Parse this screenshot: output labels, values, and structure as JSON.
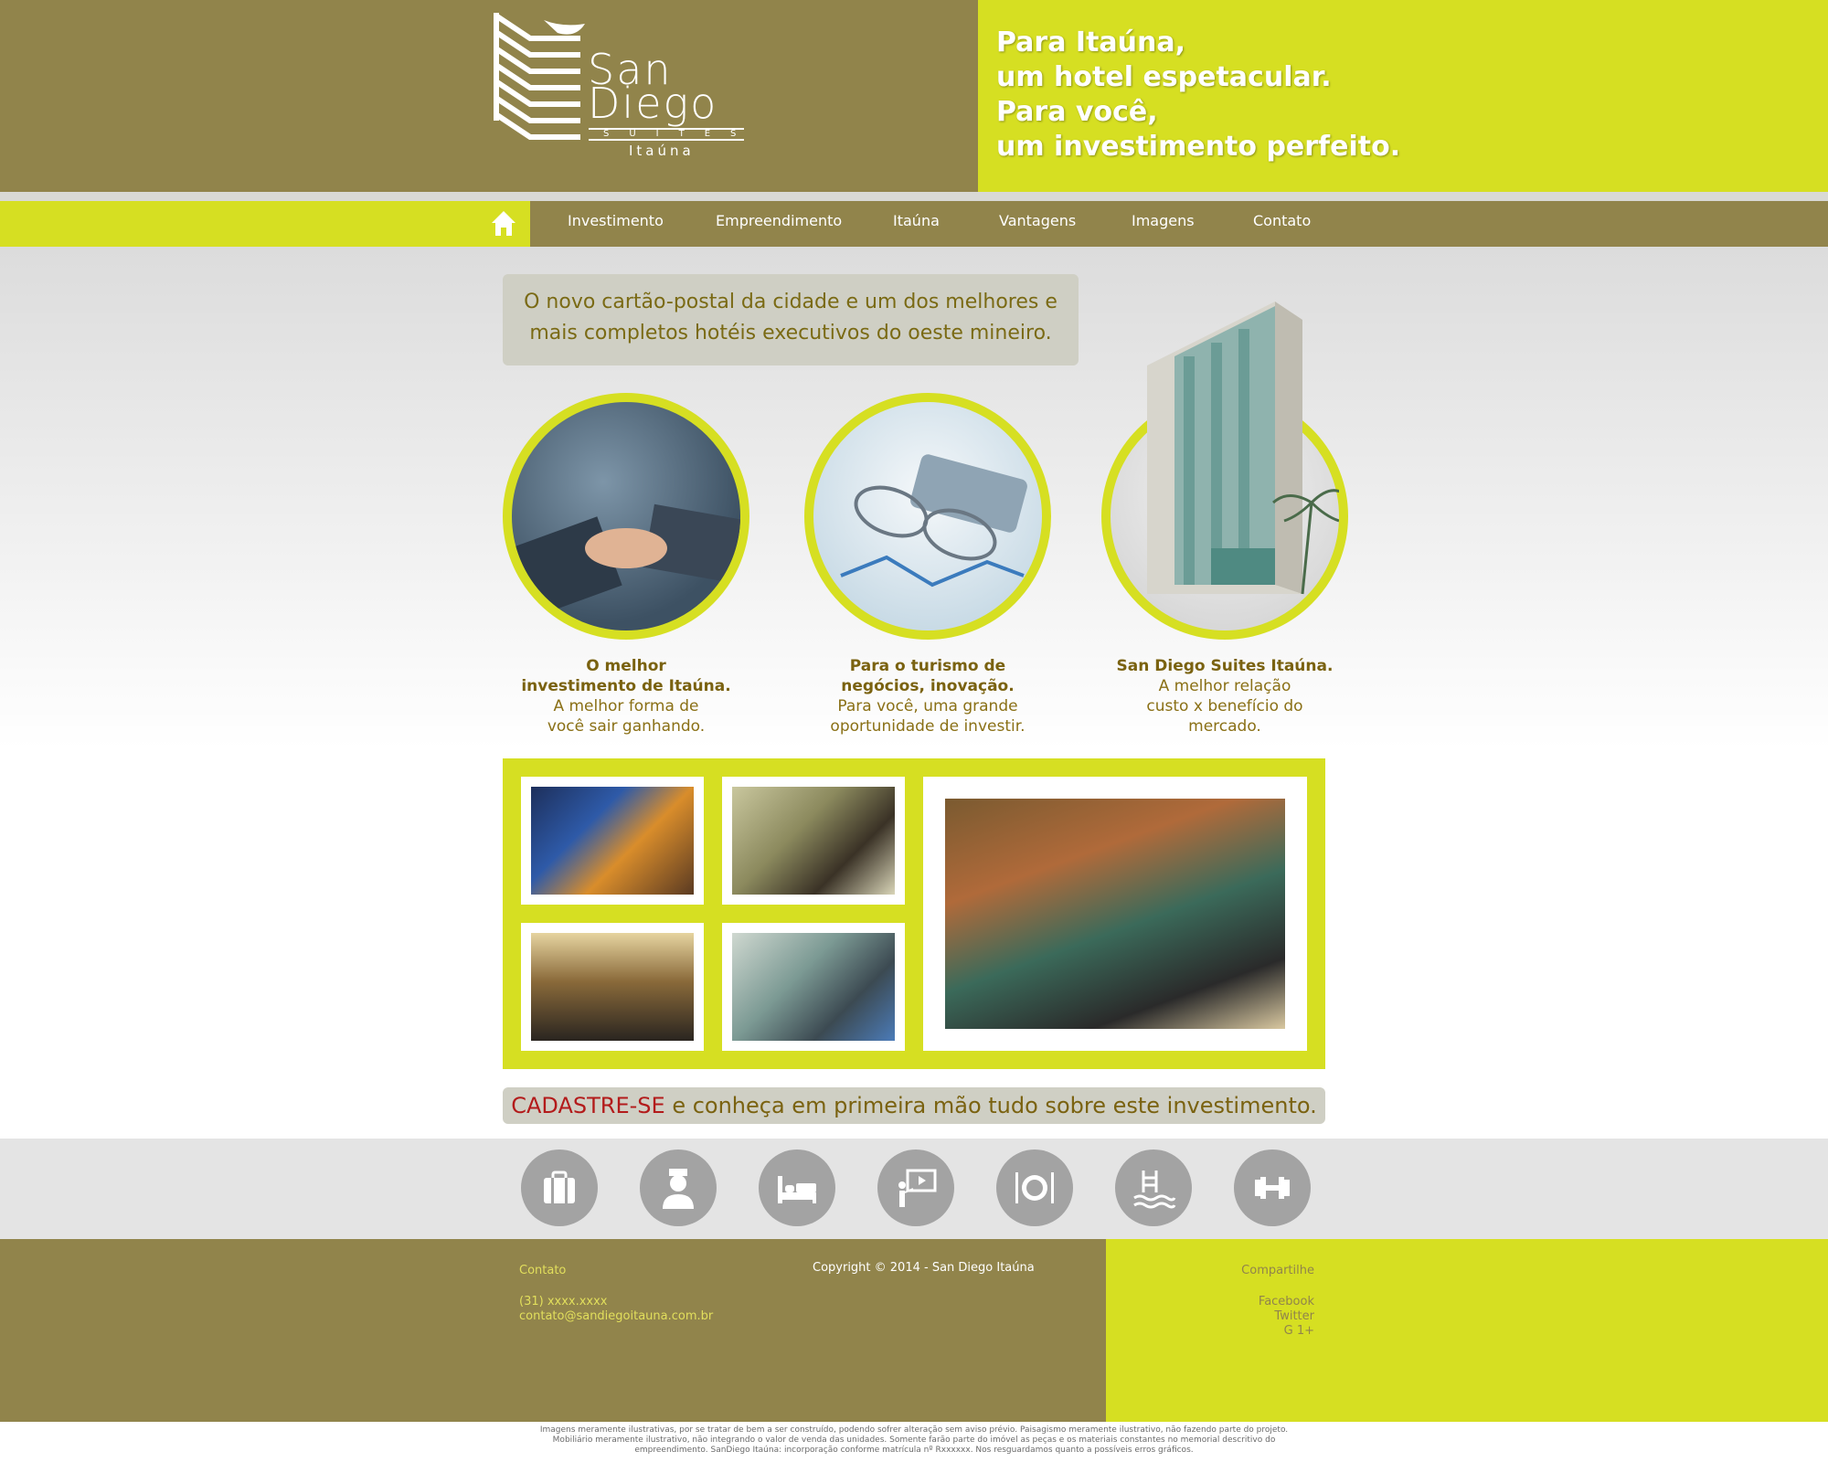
{
  "brand": {
    "name_line1": "San",
    "name_line2": "Diego",
    "suites": "SUITES",
    "city": "Itaúna"
  },
  "tagline": [
    "Para Itaúna,",
    "um hotel espetacular.",
    "Para você,",
    "um investimento perfeito."
  ],
  "nav": {
    "items": [
      "Investimento",
      "Empreendimento",
      "Itaúna",
      "Vantagens",
      "Imagens",
      "Contato"
    ]
  },
  "intro": "O novo cartão-postal da cidade e um dos melhores e mais completos hotéis executivos do oeste mineiro.",
  "features": [
    {
      "title": [
        "O melhor",
        "investimento de Itaúna."
      ],
      "text": [
        "A melhor forma de",
        "você sair ganhando."
      ]
    },
    {
      "title": [
        "Para o turismo de",
        "negócios, inovação."
      ],
      "text": [
        "Para você, uma grande",
        "oportunidade de investir."
      ]
    },
    {
      "title": [
        "San Diego Suites Itaúna."
      ],
      "text": [
        "A melhor relação",
        "custo x benefício do",
        "mercado."
      ]
    }
  ],
  "cadastre": {
    "highlight": "CADASTRE-SE",
    "rest": " e conheça em primeira mão tudo sobre este investimento."
  },
  "services": [
    "luggage-icon",
    "bellboy-icon",
    "bed-icon",
    "presentation-icon",
    "dining-icon",
    "pool-icon",
    "gym-icon"
  ],
  "footer": {
    "contact_title": "Contato",
    "phone": "(31) xxxx.xxxx",
    "email": "contato@sandiegoitauna.com.br",
    "copyright": "Copyright © 2014 - San Diego Itaúna",
    "share_title": "Compartilhe",
    "share_links": [
      "Facebook",
      "Twitter",
      "G 1+"
    ]
  },
  "legal": [
    "Imagens meramente ilustrativas, por se tratar de bem a ser construído, podendo sofrer alteração sem aviso prévio. Paisagismo meramente ilustrativo, não fazendo parte do projeto.",
    "Mobiliário meramente ilustrativo, não integrando o valor de venda das unidades. Somente farão parte do imóvel as peças e os materiais constantes no memorial descritivo do",
    "empreendimento. SanDiego Itaúna: incorporação conforme matrícula nº Rxxxxxx. Nos resguardamos quanto a possíveis erros gráficos."
  ],
  "colors": {
    "olive": "#91844b",
    "lime": "#d6df22",
    "gray_band": "#cfcfc4",
    "icon_gray": "#a3a3a3",
    "highlight_red": "#b31b1b"
  }
}
